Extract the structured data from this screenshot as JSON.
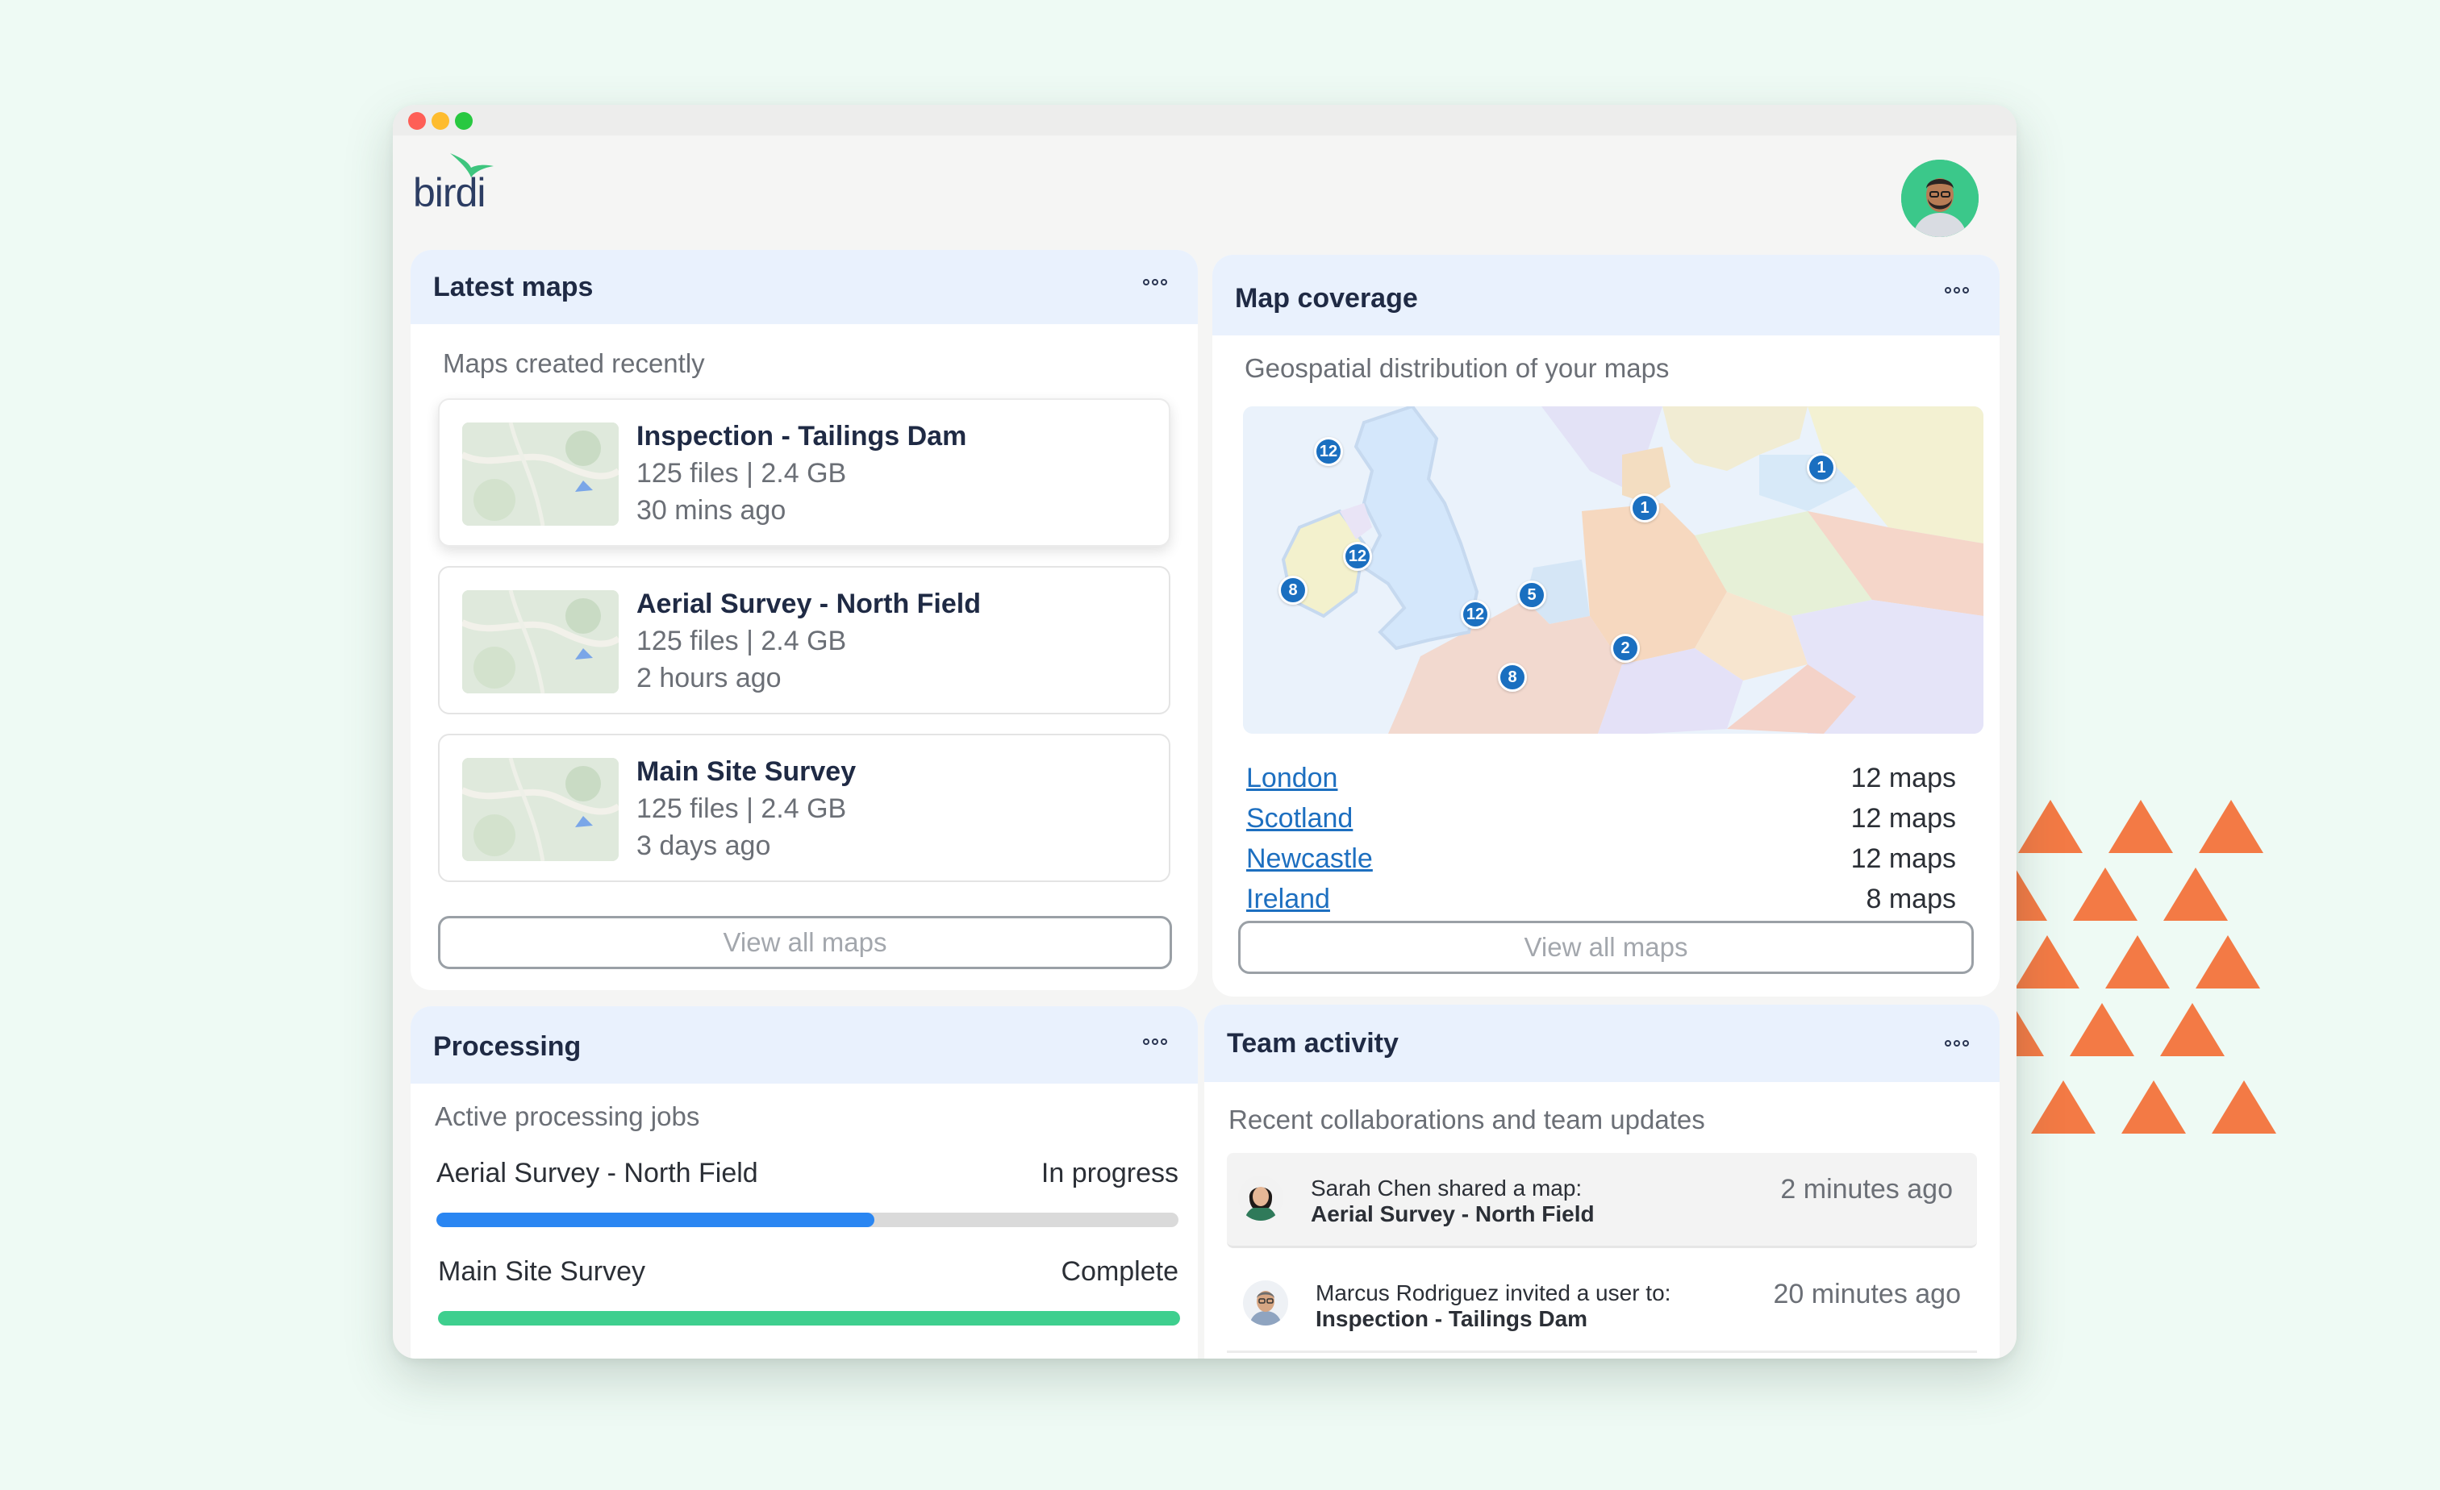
{
  "app": {
    "logo_text": "birdi"
  },
  "latest_maps": {
    "title": "Latest maps",
    "subtitle": "Maps created recently",
    "items": [
      {
        "name": "Inspection - Tailings Dam",
        "meta": "125 files |  2.4 GB",
        "time": "30 mins ago"
      },
      {
        "name": "Aerial Survey - North Field",
        "meta": "125 files |  2.4 GB",
        "time": "2 hours ago"
      },
      {
        "name": "Main Site Survey",
        "meta": "125 files |  2.4 GB",
        "time": "3 days ago"
      }
    ],
    "button_label": "View all maps"
  },
  "map_coverage": {
    "title": "Map coverage",
    "subtitle": "Geospatial distribution of your maps",
    "pins": [
      "12",
      "1",
      "1",
      "12",
      "8",
      "5",
      "12",
      "2",
      "8"
    ],
    "locations": [
      {
        "name": "London",
        "count": "12 maps"
      },
      {
        "name": "Scotland",
        "count": "12 maps"
      },
      {
        "name": "Newcastle",
        "count": "12 maps"
      },
      {
        "name": "Ireland",
        "count": "8 maps"
      }
    ],
    "button_label": "View all maps"
  },
  "processing": {
    "title": "Processing",
    "subtitle": "Active processing jobs",
    "jobs": [
      {
        "name": "Aerial Survey - North Field",
        "status": "In progress",
        "progress": 0.59,
        "color": "#2a86f2"
      },
      {
        "name": "Main Site Survey",
        "status": "Complete",
        "progress": 1.0,
        "color": "#3ecf8e"
      }
    ]
  },
  "team_activity": {
    "title": "Team activity",
    "subtitle": "Recent collaborations and team updates",
    "items": [
      {
        "text": "Sarah Chen shared a map:",
        "target": "Aerial Survey - North Field",
        "time": "2 minutes ago"
      },
      {
        "text": "Marcus Rodriguez invited a user to:",
        "target": "Inspection - Tailings Dam",
        "time": "20 minutes ago"
      }
    ]
  },
  "colors": {
    "accent_blue": "#1d6fc0",
    "decor_orange": "#f37a45",
    "header_bg": "#e9f1fd"
  }
}
